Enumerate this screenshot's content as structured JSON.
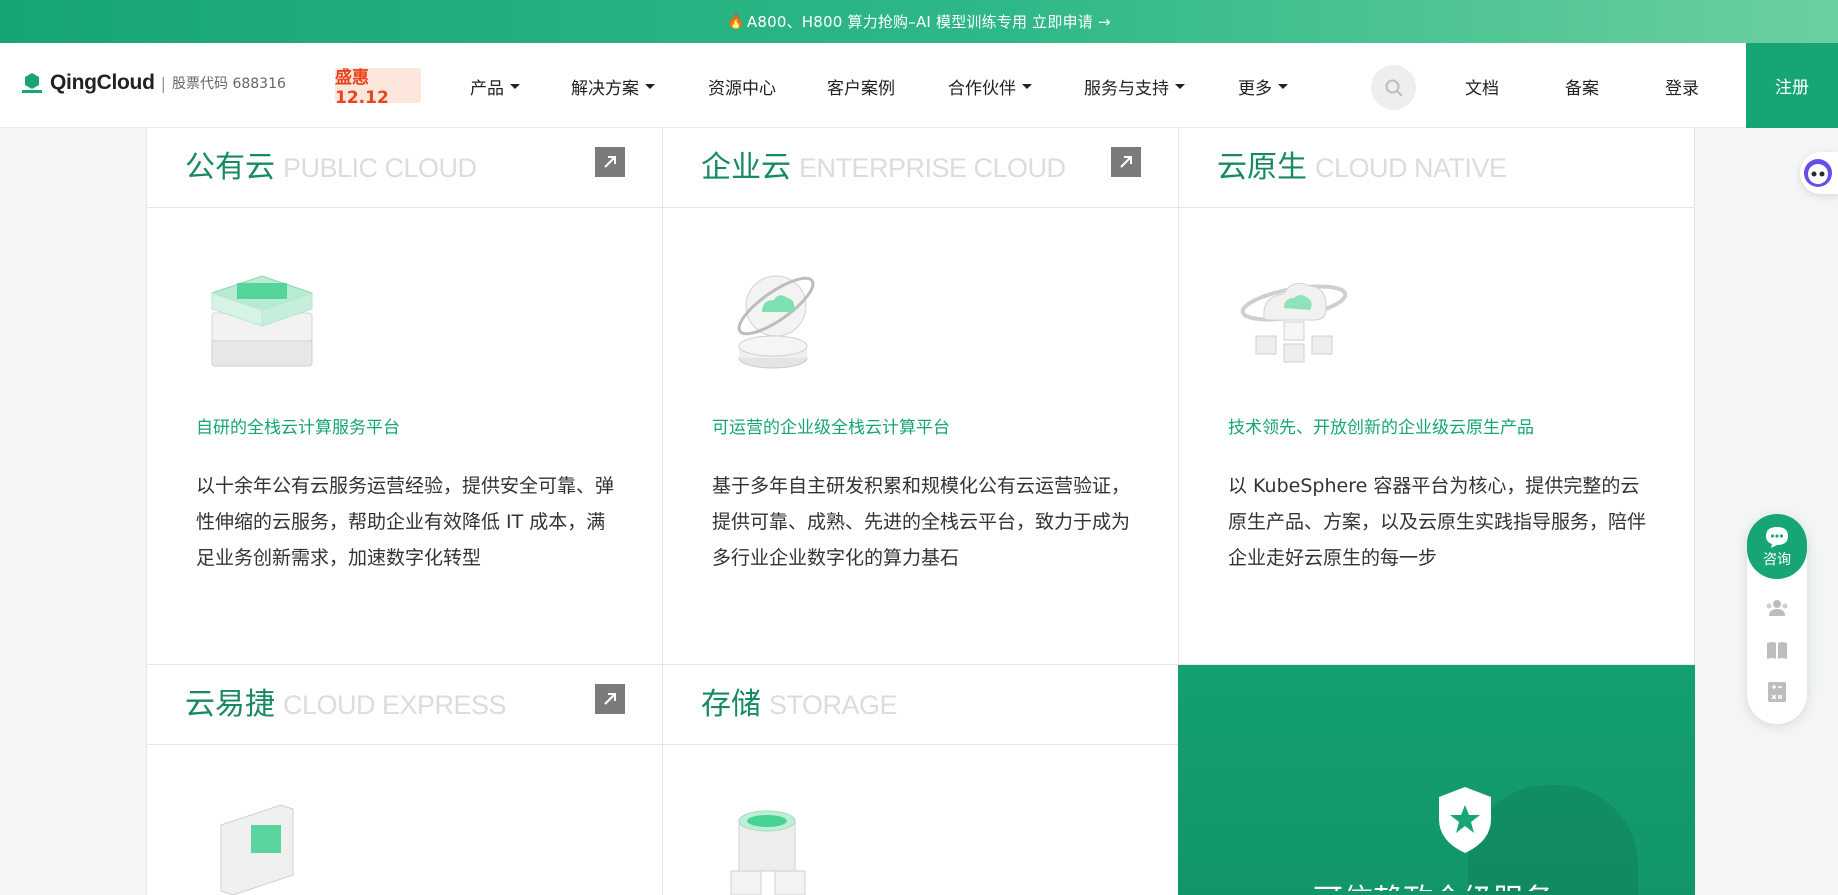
{
  "banner": {
    "text": "A800、H800 算力抢购–AI 模型训练专用 立即申请 →"
  },
  "header": {
    "logo_text": "QingCloud",
    "stock_text": "股票代码 688316",
    "promo": "盛惠12.12",
    "nav": [
      {
        "label": "产品",
        "dropdown": true
      },
      {
        "label": "解决方案",
        "dropdown": true
      },
      {
        "label": "资源中心",
        "dropdown": false
      },
      {
        "label": "客户案例",
        "dropdown": false
      },
      {
        "label": "合作伙伴",
        "dropdown": true
      },
      {
        "label": "服务与支持",
        "dropdown": true
      },
      {
        "label": "更多",
        "dropdown": true
      }
    ],
    "docs": "文档",
    "beian": "备案",
    "login": "登录",
    "register": "注册"
  },
  "cards": [
    {
      "title": "公有云",
      "subtitle": "PUBLIC CLOUD",
      "tag": "自研的全栈云计算服务平台",
      "desc": "以十余年公有云服务运营经验，提供安全可靠、弹性伸缩的云服务，帮助企业有效降低 IT 成本，满足业务创新需求，加速数字化转型",
      "icon": "stack-icon"
    },
    {
      "title": "企业云",
      "subtitle": "ENTERPRISE CLOUD",
      "tag": "可运营的企业级全栈云计算平台",
      "desc": "基于多年自主研发积累和规模化公有云运营验证，提供可靠、成熟、先进的全栈云平台，致力于成为多行业企业数字化的算力基石",
      "icon": "orbit-cloud-icon"
    },
    {
      "title": "云原生",
      "subtitle": "CLOUD NATIVE",
      "tag": "技术领先、开放创新的企业级云原生产品",
      "desc": "以 KubeSphere 容器平台为核心，提供完整的云原生产品、方案，以及云原生实践指导服务，陪伴企业走好云原生的每一步",
      "icon": "cloud-cubes-icon"
    },
    {
      "title": "云易捷",
      "subtitle": "CLOUD EXPRESS",
      "icon": "monitor-cube-icon"
    },
    {
      "title": "存储",
      "subtitle": "STORAGE",
      "icon": "storage-cylinder-icon"
    }
  ],
  "feature": {
    "title": "可信赖政企级服务"
  },
  "side": {
    "consult": "咨询"
  },
  "colors": {
    "brand": "#17a673",
    "promo": "#e8451f"
  }
}
